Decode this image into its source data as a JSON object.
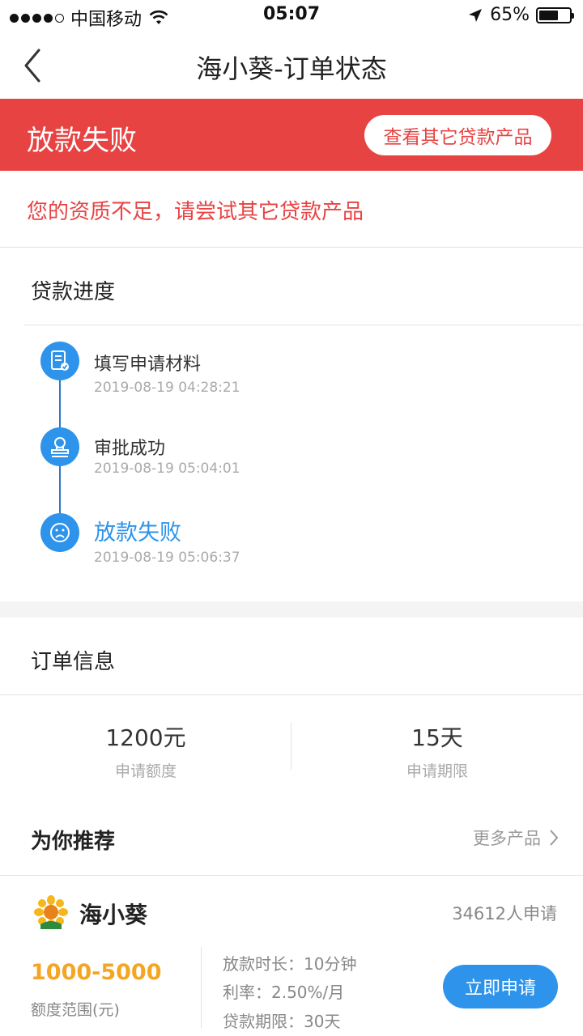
{
  "status_bar": {
    "carrier": "中国移动",
    "time": "05:07",
    "battery": "65%",
    "battery_level": 0.65,
    "signal_bars_filled": 4,
    "signal_bars_total": 5
  },
  "nav": {
    "title": "海小葵-订单状态",
    "back_icon": "chevron-left-icon"
  },
  "banner": {
    "status": "放款失败",
    "button_label": "查看其它贷款产品",
    "color": "#e84343"
  },
  "reason": "您的资质不足，请尝试其它贷款产品",
  "progress": {
    "title": "贷款进度",
    "steps": [
      {
        "title": "填写申请材料",
        "time": "2019-08-19 04:28:21",
        "icon": "document-check-icon"
      },
      {
        "title": "审批成功",
        "time": "2019-08-19 05:04:01",
        "icon": "stamp-icon"
      },
      {
        "title": "放款失败",
        "time": "2019-08-19 05:06:37",
        "icon": "sad-face-icon"
      }
    ],
    "accent_color": "#2e93ea"
  },
  "order": {
    "title": "订单信息",
    "amount_value": "1200元",
    "amount_label": "申请额度",
    "term_value": "15天",
    "term_label": "申请期限"
  },
  "recommend": {
    "title": "为你推荐",
    "more_label": "更多产品",
    "product": {
      "logo_icon": "sunflower-icon",
      "name": "海小葵",
      "applicants": "34612人申请",
      "range": "1000-5000",
      "range_label": "额度范围(元)",
      "details": [
        "放款时长：10分钟",
        "利率：2.50%/月",
        "贷款期限：30天"
      ],
      "apply_label": "立即申请",
      "range_color": "#f4a623"
    }
  }
}
